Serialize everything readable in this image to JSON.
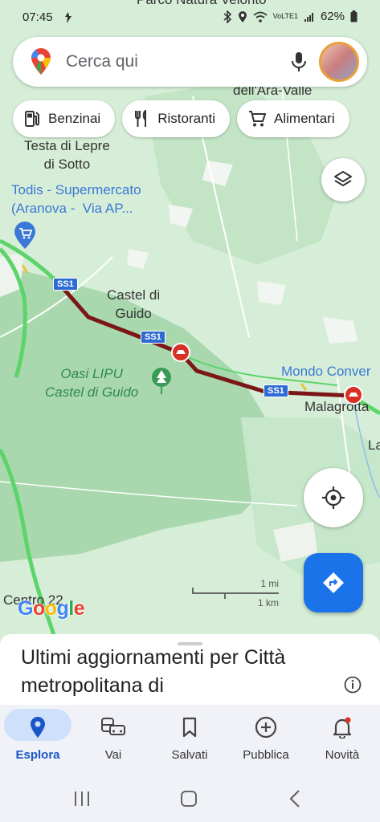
{
  "status_bar": {
    "time": "07:45",
    "network_label": "VoLTE1",
    "battery": "62%"
  },
  "search": {
    "placeholder": "Cerca qui"
  },
  "chips": [
    {
      "label": "Benzinai",
      "icon": "gas-station-icon"
    },
    {
      "label": "Ristoranti",
      "icon": "fork-knife-icon"
    },
    {
      "label": "Alimentari",
      "icon": "shopping-cart-icon"
    }
  ],
  "map": {
    "labels": {
      "top_partial": "Parco Natura Velorito",
      "ara_valle": "dell'Ara-Valle",
      "testa_di_lepre": "Testa di Lepre\ndi Sotto",
      "todis": "Todis - Supermercato\n(Aranova -  Via AP...",
      "castel_di_guido": "Castel di\nGuido",
      "oasi": "Oasi LIPU\nCastel di Guido",
      "mondo": "Mondo Conver",
      "malagrotta": "Malagrotta",
      "la": "La",
      "centro": "Centro 22"
    },
    "road_shields": [
      "SS1",
      "SS1",
      "SS1"
    ],
    "scale": {
      "imperial": "1 mi",
      "metric": "1 km"
    },
    "attribution": "Google",
    "colors": {
      "traffic_heavy": "#7b1717",
      "traffic_free": "#5dd46a",
      "accent": "#1a73e8"
    }
  },
  "sheet": {
    "title": "Ultimi aggiornamenti per Città metropolitana di"
  },
  "nav": {
    "items": [
      {
        "label": "Esplora",
        "icon": "location-pin-icon",
        "active": true
      },
      {
        "label": "Vai",
        "icon": "commute-icon",
        "active": false
      },
      {
        "label": "Salvati",
        "icon": "bookmark-icon",
        "active": false
      },
      {
        "label": "Pubblica",
        "icon": "add-circle-icon",
        "active": false
      },
      {
        "label": "Novità",
        "icon": "bell-icon",
        "active": false
      }
    ]
  }
}
